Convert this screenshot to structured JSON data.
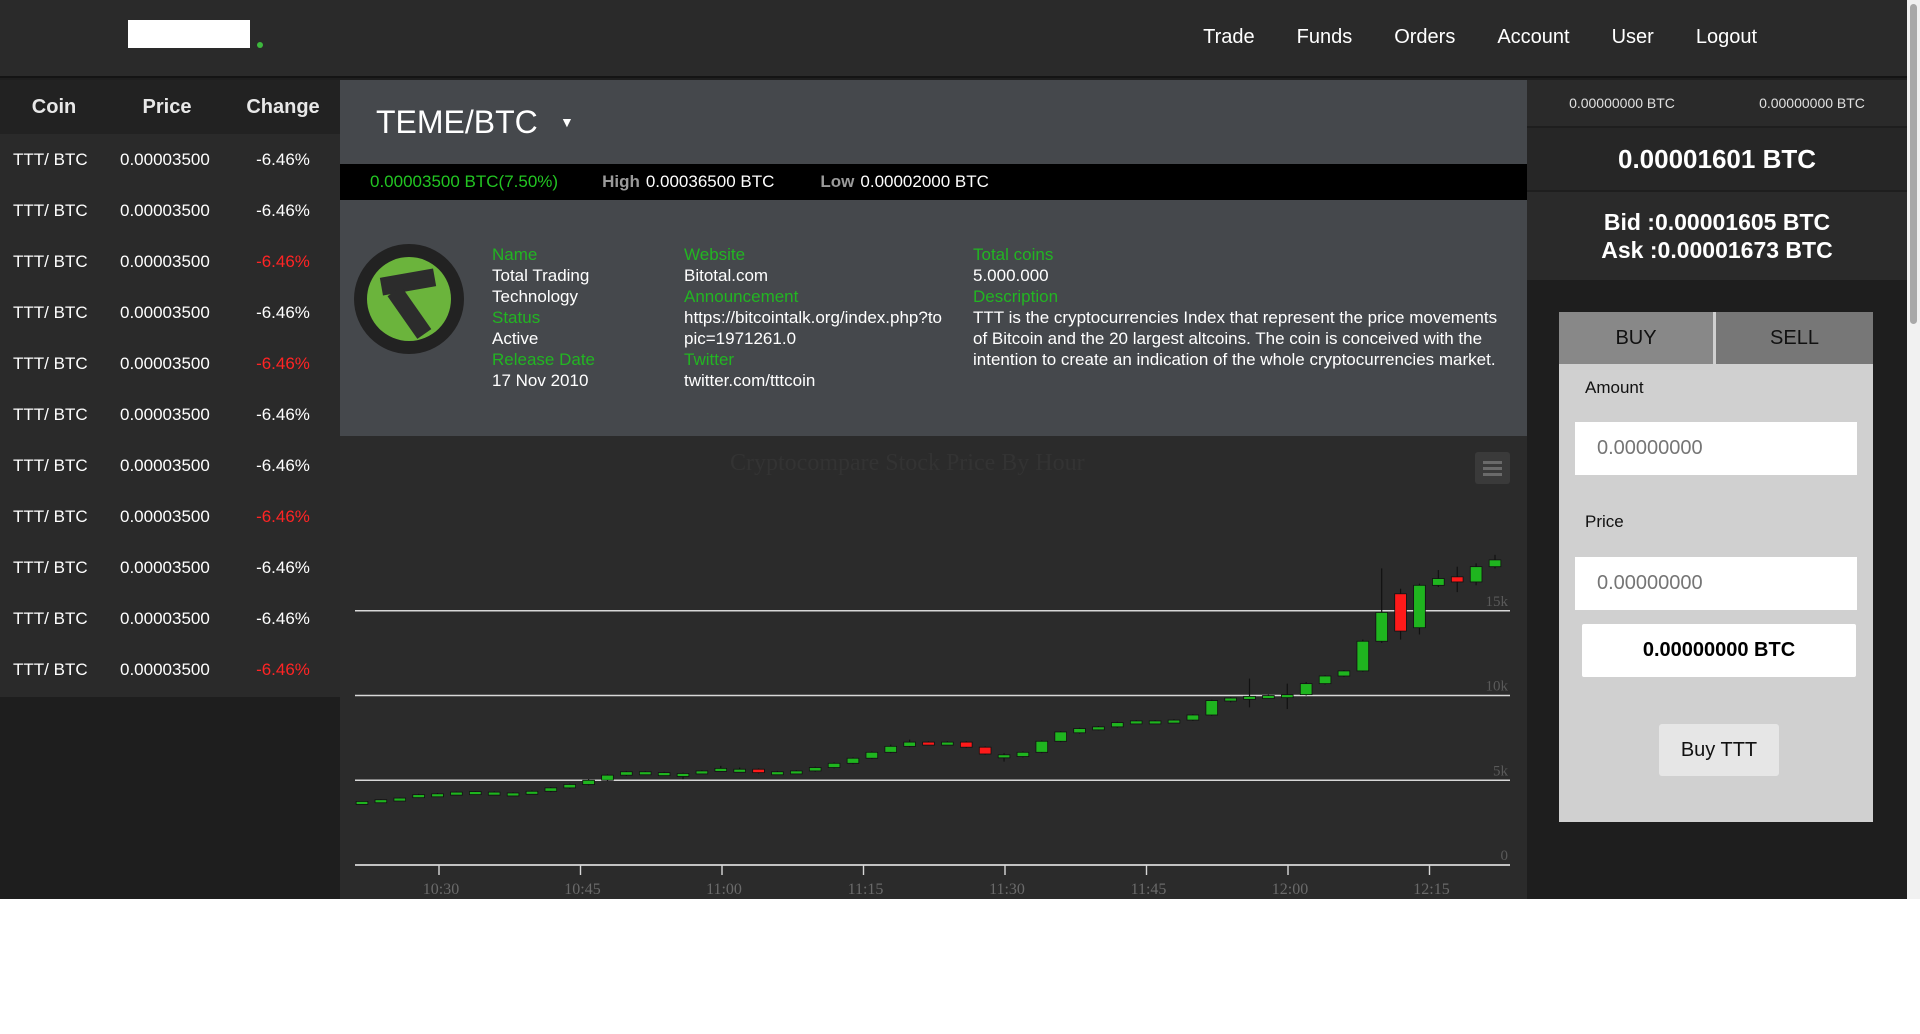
{
  "nav": {
    "items": [
      "Trade",
      "Funds",
      "Orders",
      "Account",
      "User",
      "Logout"
    ]
  },
  "market": {
    "headers": {
      "coin": "Coin",
      "price": "Price",
      "change": "Change"
    },
    "rows": [
      {
        "coin": "TTT/ BTC",
        "price": "0.00003500",
        "change": "-6.46%",
        "negative": false
      },
      {
        "coin": "TTT/ BTC",
        "price": "0.00003500",
        "change": "-6.46%",
        "negative": false
      },
      {
        "coin": "TTT/ BTC",
        "price": "0.00003500",
        "change": "-6.46%",
        "negative": true
      },
      {
        "coin": "TTT/ BTC",
        "price": "0.00003500",
        "change": "-6.46%",
        "negative": false
      },
      {
        "coin": "TTT/ BTC",
        "price": "0.00003500",
        "change": "-6.46%",
        "negative": true
      },
      {
        "coin": "TTT/ BTC",
        "price": "0.00003500",
        "change": "-6.46%",
        "negative": false
      },
      {
        "coin": "TTT/ BTC",
        "price": "0.00003500",
        "change": "-6.46%",
        "negative": false
      },
      {
        "coin": "TTT/ BTC",
        "price": "0.00003500",
        "change": "-6.46%",
        "negative": true
      },
      {
        "coin": "TTT/ BTC",
        "price": "0.00003500",
        "change": "-6.46%",
        "negative": false
      },
      {
        "coin": "TTT/ BTC",
        "price": "0.00003500",
        "change": "-6.46%",
        "negative": false
      },
      {
        "coin": "TTT/ BTC",
        "price": "0.00003500",
        "change": "-6.46%",
        "negative": true
      }
    ]
  },
  "pair": {
    "title": "TEME/BTC",
    "caret": "▼"
  },
  "ticker": {
    "price": "0.00003500 BTC(7.50%)",
    "high_label": "High",
    "high_value": "0.00036500 BTC",
    "low_label": "Low",
    "low_value": "0.00002000 BTC"
  },
  "coin_info": {
    "name_label": "Name",
    "name_value": "Total Trading Technology",
    "status_label": "Status",
    "status_value": "Active",
    "release_label": "Release Date",
    "release_value": "17 Nov 2010",
    "website_label": "Website",
    "website_value": "Bitotal.com",
    "announcement_label": "Announcement",
    "announcement_value": "https://bitcointalk.org/index.php?topic=1971261.0",
    "twitter_label": "Twitter",
    "twitter_value": "twitter.com/tttcoin",
    "total_coins_label": "Total coins",
    "total_coins_value": "5.000.000",
    "description_label": "Description",
    "description_value": "TTT is the cryptocurrencies Index that represent the price movements of Bitcoin and the 20 largest altcoins. The coin is conceived with the intention to create an indication of the whole cryptocurrencies market."
  },
  "chart_data": {
    "type": "candlestick",
    "title": "Cryptocompare Stock Price By Hour",
    "x_ticks": [
      "10:30",
      "10:45",
      "11:00",
      "11:15",
      "11:30",
      "11:45",
      "12:00",
      "12:15"
    ],
    "y_ticks": [
      "0",
      "5k",
      "10k",
      "15k"
    ],
    "ylim": [
      0,
      20000
    ],
    "grid": true,
    "colors": {
      "up": "#1fb51f",
      "down": "#ff1a1a"
    },
    "candles": [
      {
        "o": 3700,
        "c": 3750,
        "h": 3780,
        "l": 3650
      },
      {
        "o": 3800,
        "c": 3850,
        "h": 3880,
        "l": 3750
      },
      {
        "o": 3850,
        "c": 3950,
        "h": 3980,
        "l": 3800
      },
      {
        "o": 4000,
        "c": 4150,
        "h": 4200,
        "l": 3950
      },
      {
        "o": 4150,
        "c": 4200,
        "h": 4250,
        "l": 4100
      },
      {
        "o": 4250,
        "c": 4300,
        "h": 4330,
        "l": 4200
      },
      {
        "o": 4300,
        "c": 4330,
        "h": 4360,
        "l": 4250
      },
      {
        "o": 4300,
        "c": 4300,
        "h": 4350,
        "l": 4250
      },
      {
        "o": 4250,
        "c": 4250,
        "h": 4300,
        "l": 4200
      },
      {
        "o": 4300,
        "c": 4350,
        "h": 4400,
        "l": 4250
      },
      {
        "o": 4350,
        "c": 4550,
        "h": 4600,
        "l": 4300
      },
      {
        "o": 4550,
        "c": 4750,
        "h": 4800,
        "l": 4500
      },
      {
        "o": 4750,
        "c": 5000,
        "h": 5050,
        "l": 4700
      },
      {
        "o": 5000,
        "c": 5300,
        "h": 5350,
        "l": 4950
      },
      {
        "o": 5300,
        "c": 5500,
        "h": 5550,
        "l": 5250
      },
      {
        "o": 5450,
        "c": 5500,
        "h": 5550,
        "l": 5400
      },
      {
        "o": 5450,
        "c": 5450,
        "h": 5500,
        "l": 5350
      },
      {
        "o": 5300,
        "c": 5400,
        "h": 5450,
        "l": 5050
      },
      {
        "o": 5450,
        "c": 5550,
        "h": 5600,
        "l": 5400
      },
      {
        "o": 5600,
        "c": 5700,
        "h": 5850,
        "l": 5550
      },
      {
        "o": 5650,
        "c": 5650,
        "h": 5750,
        "l": 5550
      },
      {
        "o": 5650,
        "c": 5450,
        "h": 5700,
        "l": 5400
      },
      {
        "o": 5400,
        "c": 5500,
        "h": 5550,
        "l": 5350
      },
      {
        "o": 5500,
        "c": 5550,
        "h": 5600,
        "l": 5450
      },
      {
        "o": 5550,
        "c": 5750,
        "h": 5800,
        "l": 5500
      },
      {
        "o": 5750,
        "c": 6000,
        "h": 6050,
        "l": 5700
      },
      {
        "o": 6000,
        "c": 6300,
        "h": 6350,
        "l": 5950
      },
      {
        "o": 6300,
        "c": 6650,
        "h": 6700,
        "l": 6250
      },
      {
        "o": 6650,
        "c": 7000,
        "h": 7100,
        "l": 6600
      },
      {
        "o": 7000,
        "c": 7250,
        "h": 7400,
        "l": 6950
      },
      {
        "o": 7250,
        "c": 7150,
        "h": 7300,
        "l": 7050
      },
      {
        "o": 7150,
        "c": 7250,
        "h": 7300,
        "l": 7100
      },
      {
        "o": 7250,
        "c": 6950,
        "h": 7300,
        "l": 6900
      },
      {
        "o": 6950,
        "c": 6550,
        "h": 7000,
        "l": 6500
      },
      {
        "o": 6500,
        "c": 6500,
        "h": 6600,
        "l": 6100
      },
      {
        "o": 6400,
        "c": 6650,
        "h": 6700,
        "l": 6350
      },
      {
        "o": 6650,
        "c": 7300,
        "h": 7350,
        "l": 6600
      },
      {
        "o": 7300,
        "c": 7850,
        "h": 7900,
        "l": 7250
      },
      {
        "o": 7800,
        "c": 8050,
        "h": 8100,
        "l": 7750
      },
      {
        "o": 8000,
        "c": 8150,
        "h": 8200,
        "l": 7950
      },
      {
        "o": 8150,
        "c": 8400,
        "h": 8450,
        "l": 8100
      },
      {
        "o": 8400,
        "c": 8500,
        "h": 8550,
        "l": 8350
      },
      {
        "o": 8500,
        "c": 8500,
        "h": 8550,
        "l": 8450
      },
      {
        "o": 8500,
        "c": 8550,
        "h": 8600,
        "l": 8450
      },
      {
        "o": 8550,
        "c": 8850,
        "h": 8900,
        "l": 8500
      },
      {
        "o": 8850,
        "c": 9700,
        "h": 9750,
        "l": 8800
      },
      {
        "o": 9700,
        "c": 9850,
        "h": 9900,
        "l": 9600
      },
      {
        "o": 9850,
        "c": 9950,
        "h": 11000,
        "l": 9300
      },
      {
        "o": 9950,
        "c": 10000,
        "h": 10050,
        "l": 9900
      },
      {
        "o": 10000,
        "c": 10050,
        "h": 10700,
        "l": 9200
      },
      {
        "o": 10050,
        "c": 10700,
        "h": 10800,
        "l": 10000
      },
      {
        "o": 10700,
        "c": 11150,
        "h": 11200,
        "l": 10650
      },
      {
        "o": 11150,
        "c": 11450,
        "h": 11500,
        "l": 11100
      },
      {
        "o": 11450,
        "c": 13200,
        "h": 13300,
        "l": 11400
      },
      {
        "o": 13200,
        "c": 14900,
        "h": 17500,
        "l": 13100
      },
      {
        "o": 16000,
        "c": 13800,
        "h": 16300,
        "l": 13300
      },
      {
        "o": 14000,
        "c": 16500,
        "h": 16600,
        "l": 13600
      },
      {
        "o": 16500,
        "c": 16900,
        "h": 17400,
        "l": 16400
      },
      {
        "o": 17000,
        "c": 16700,
        "h": 17600,
        "l": 16100
      },
      {
        "o": 16700,
        "c": 17600,
        "h": 17800,
        "l": 16500
      },
      {
        "o": 17600,
        "c": 18000,
        "h": 18300,
        "l": 17500
      }
    ]
  },
  "balances": {
    "left": "0.00000000 BTC",
    "right": "0.00000000 BTC"
  },
  "last_price": "0.00001601 BTC",
  "bid": "Bid :0.00001605 BTC",
  "ask": "Ask :0.00001673 BTC",
  "trade": {
    "tab_buy": "BUY",
    "tab_sell": "SELL",
    "amount_label": "Amount",
    "amount_placeholder": "0.00000000",
    "price_label": "Price",
    "price_placeholder": "0.00000000",
    "total": "0.00000000 BTC",
    "submit_label": "Buy TTT"
  }
}
